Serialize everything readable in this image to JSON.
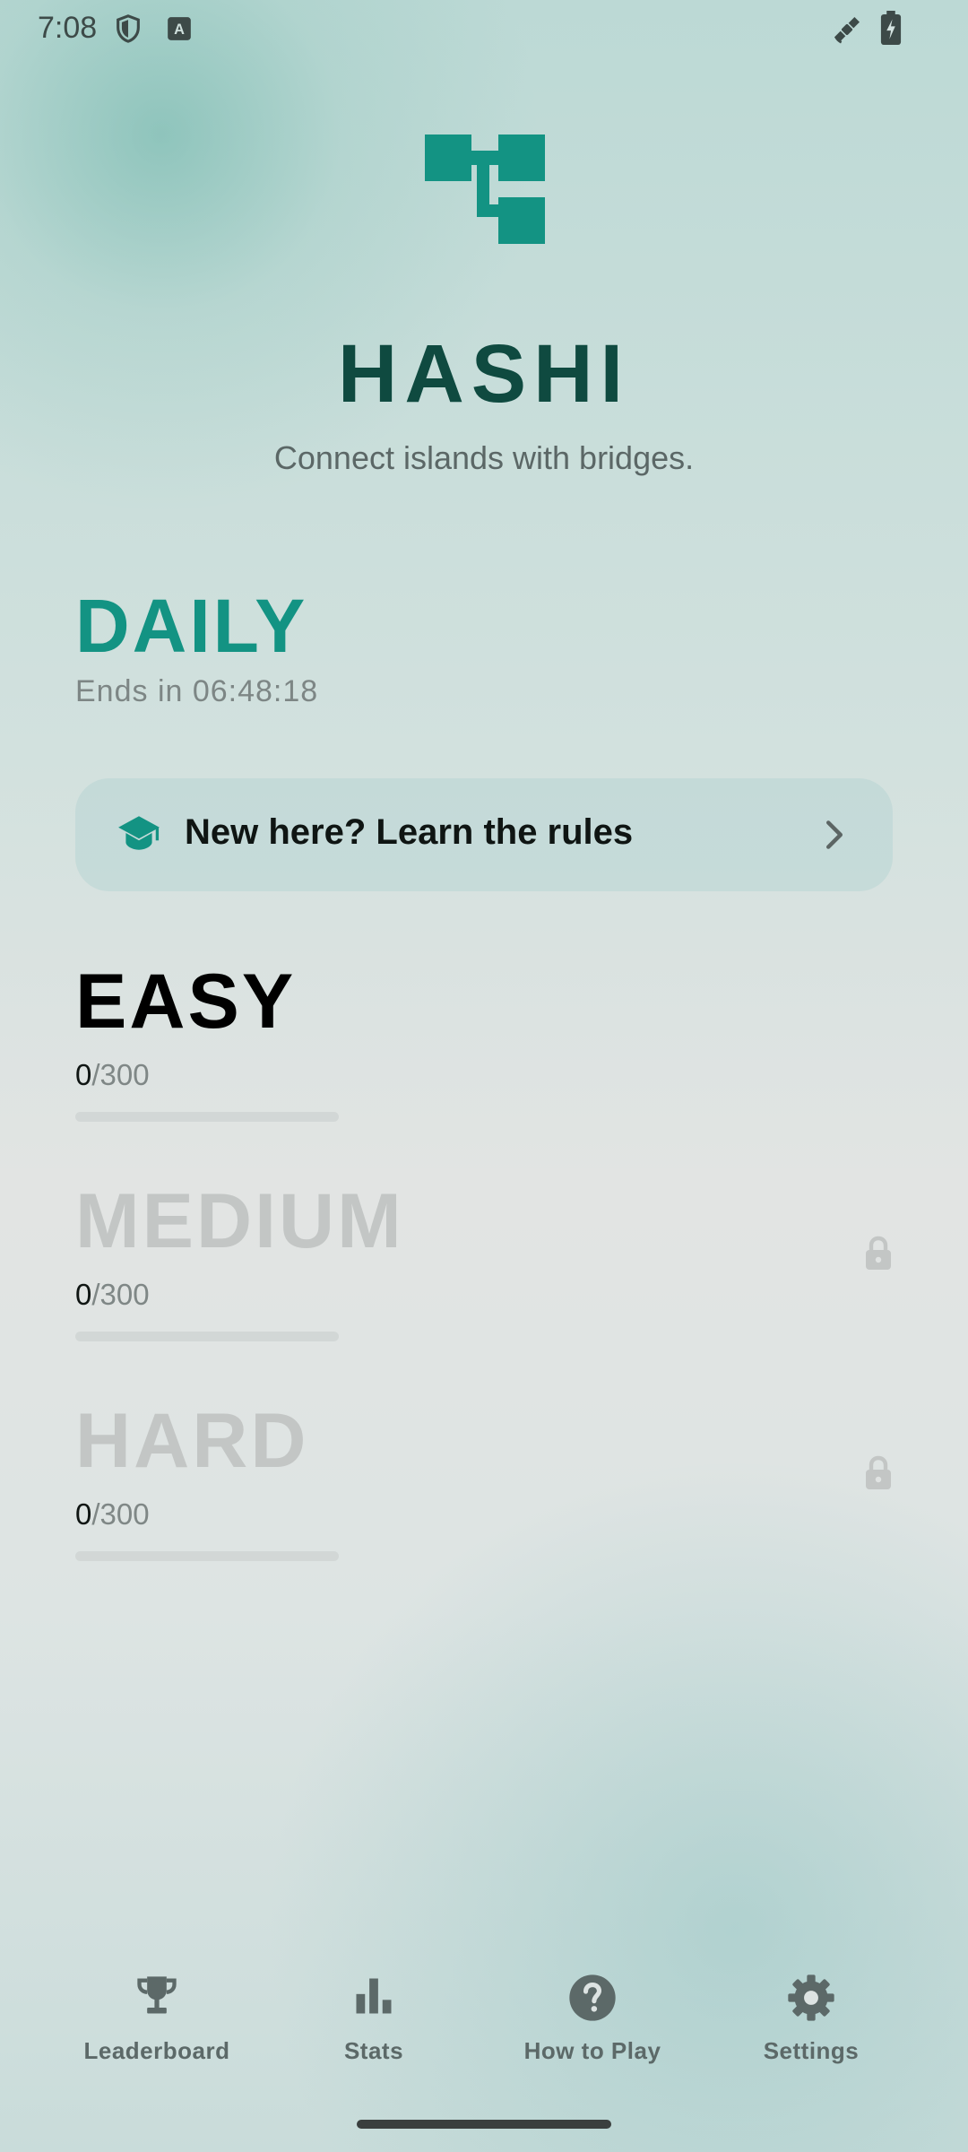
{
  "status_bar": {
    "time": "7:08",
    "left_icons": [
      "shield-icon",
      "keyboard-a-icon"
    ],
    "right_icons": [
      "satellite-icon",
      "battery-charging-icon"
    ]
  },
  "header": {
    "logo_icon": "hashi-logo-icon",
    "title": "HASHI",
    "subtitle": "Connect islands with bridges."
  },
  "daily": {
    "title": "DAILY",
    "timer": "Ends in 06:48:18"
  },
  "rules_card": {
    "icon": "graduation-cap-icon",
    "label": "New here? Learn the rules",
    "chevron": "chevron-right-icon"
  },
  "levels": [
    {
      "name": "EASY",
      "completed": "0",
      "total": "/300",
      "progress_fraction": 0,
      "locked": false
    },
    {
      "name": "MEDIUM",
      "completed": "0",
      "total": "/300",
      "progress_fraction": 0,
      "locked": true
    },
    {
      "name": "HARD",
      "completed": "0",
      "total": "/300",
      "progress_fraction": 0,
      "locked": true
    }
  ],
  "bottom_nav": [
    {
      "label": "Leaderboard",
      "icon": "trophy-icon"
    },
    {
      "label": "Stats",
      "icon": "bar-chart-icon"
    },
    {
      "label": "How to Play",
      "icon": "help-circle-icon"
    },
    {
      "label": "Settings",
      "icon": "gear-icon"
    }
  ],
  "colors": {
    "accent": "#139383",
    "title": "#0f4a40",
    "locked_text": "#c3c6c5",
    "nav_icon": "#5c6968"
  }
}
